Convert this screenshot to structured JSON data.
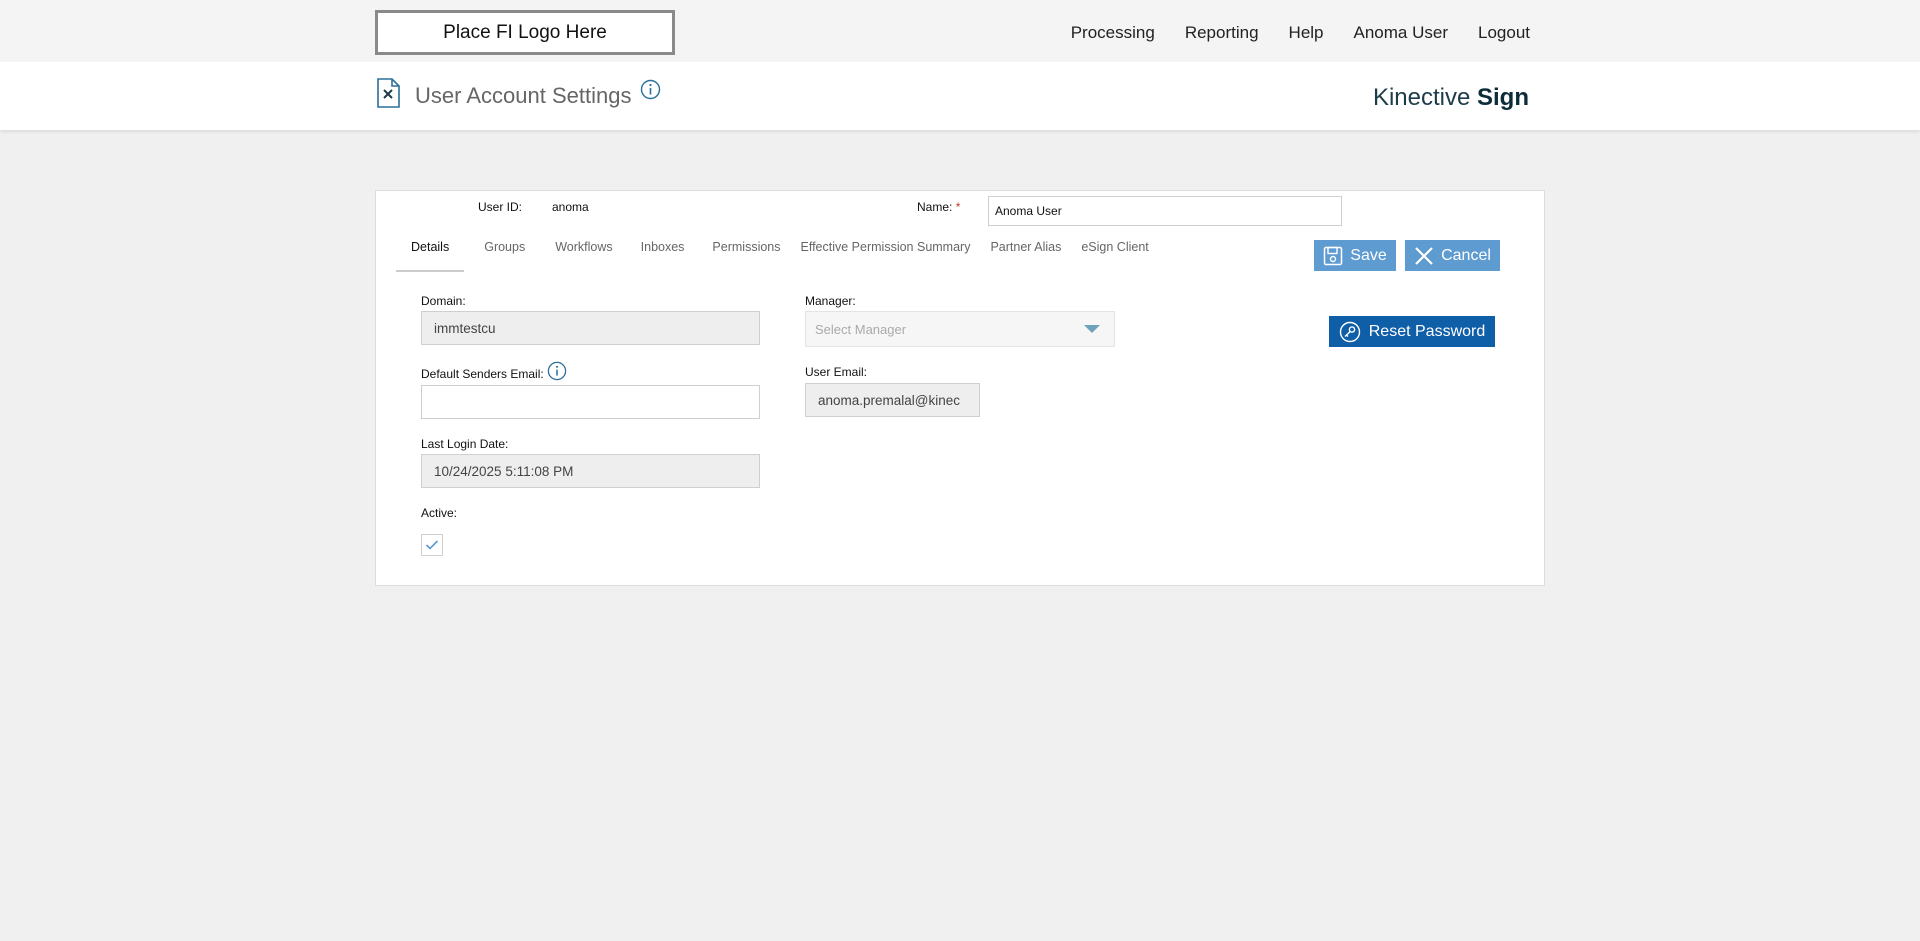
{
  "header": {
    "logo_text": "Place FI Logo Here",
    "nav": [
      "Processing",
      "Reporting",
      "Help",
      "Anoma User",
      "Logout"
    ]
  },
  "titlebar": {
    "title": "User Account Settings",
    "brand_light": "Kinective",
    "brand_bold": "Sign"
  },
  "user": {
    "id_label": "User ID:",
    "id_value": "anoma",
    "name_label": "Name:",
    "name_required": "*",
    "name_value": "Anoma User"
  },
  "tabs": [
    {
      "label": "Details",
      "active": true
    },
    {
      "label": "Groups"
    },
    {
      "label": "Workflows"
    },
    {
      "label": "Inboxes"
    },
    {
      "label": "Permissions"
    },
    {
      "label": "Effective Permission Summary"
    },
    {
      "label": "Partner Alias"
    },
    {
      "label": "eSign Client"
    }
  ],
  "actions": {
    "save": "Save",
    "cancel": "Cancel",
    "reset_password": "Reset Password"
  },
  "details": {
    "domain_label": "Domain:",
    "domain_value": "immtestcu",
    "default_email_label": "Default Senders Email:",
    "default_email_value": "",
    "last_login_label": "Last Login Date:",
    "last_login_value": "10/24/2025 5:11:08 PM",
    "active_label": "Active:",
    "active_checked": true,
    "manager_label": "Manager:",
    "manager_placeholder": "Select Manager",
    "user_email_label": "User Email:",
    "user_email_value": "anoma.premalal@kinec"
  },
  "colors": {
    "button_light": "#5e9bd0",
    "button_dark": "#0f5ea8",
    "brand": "#0d2c3a"
  }
}
